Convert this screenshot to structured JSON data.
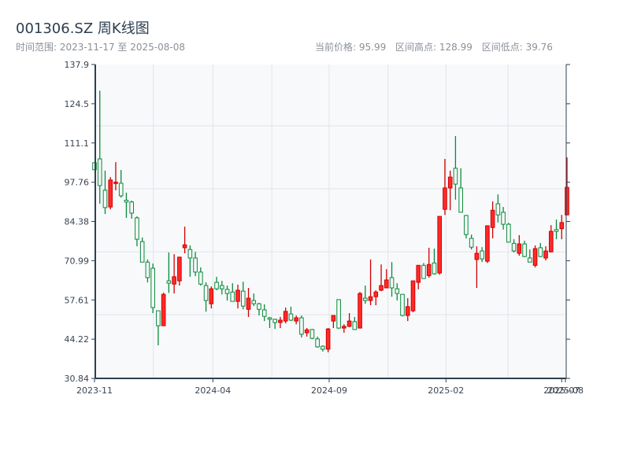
{
  "header": {
    "title": "001306.SZ 周K线图",
    "range_label": "时间范围: 2023-11-17 至 2025-08-08",
    "current_price": "当前价格: 95.99",
    "range_high": "区间高点: 128.99",
    "range_low": "区间低点: 39.76"
  },
  "colors": {
    "up": "#ff2a2a",
    "up_stroke": "#d10000",
    "down": "#0b8a3a",
    "plot_bg": "#f7f9fb",
    "axis": "#2e3f52"
  },
  "chart_data": {
    "type": "candlestick",
    "title": "001306.SZ 周K线图",
    "ylim": [
      30.84,
      137.9
    ],
    "yticks": [
      "137.9",
      "124.5",
      "111.1",
      "97.76",
      "84.38",
      "70.99",
      "57.61",
      "44.22",
      "30.84"
    ],
    "xticks": [
      {
        "label": "2023-11",
        "index": 0
      },
      {
        "label": "2024-04",
        "index": 22.3
      },
      {
        "label": "2024-09",
        "index": 44.2
      },
      {
        "label": "2025-02",
        "index": 66.2
      },
      {
        "label": "2025-07",
        "index": 88.0
      },
      {
        "label": "2025-08",
        "index": 88.7
      }
    ],
    "grid": true,
    "ohlc": [
      [
        104.4,
        104.5,
        101.9,
        102.0
      ],
      [
        105.7,
        128.99,
        90.4,
        96.6
      ],
      [
        95.0,
        101.7,
        86.9,
        89.1
      ],
      [
        89.3,
        99.5,
        88.5,
        98.5
      ],
      [
        97.3,
        104.6,
        95.0,
        97.8
      ],
      [
        97.4,
        101.9,
        92.5,
        93.1
      ],
      [
        91.6,
        94.2,
        85.6,
        91.0
      ],
      [
        91.0,
        91.5,
        85.3,
        87.2
      ],
      [
        85.6,
        86.1,
        75.9,
        78.3
      ],
      [
        77.5,
        78.9,
        70.5,
        70.5
      ],
      [
        70.5,
        71.4,
        63.6,
        65.2
      ],
      [
        68.4,
        70.0,
        53.1,
        55.0
      ],
      [
        53.9,
        53.9,
        42.1,
        48.8
      ],
      [
        48.8,
        60.1,
        48.8,
        59.5
      ],
      [
        64.1,
        73.8,
        60.0,
        63.3
      ],
      [
        63.0,
        73.2,
        59.8,
        65.5
      ],
      [
        64.1,
        72.2,
        62.5,
        72.2
      ],
      [
        75.4,
        82.6,
        73.5,
        76.4
      ],
      [
        74.8,
        76.2,
        65.5,
        71.9
      ],
      [
        71.9,
        74.0,
        65.7,
        67.1
      ],
      [
        67.1,
        68.7,
        62.5,
        63.0
      ],
      [
        62.5,
        63.6,
        53.6,
        57.4
      ],
      [
        56.3,
        62.2,
        54.7,
        61.4
      ],
      [
        63.6,
        65.5,
        60.9,
        61.4
      ],
      [
        62.5,
        64.1,
        59.5,
        61.4
      ],
      [
        61.2,
        62.5,
        57.4,
        59.8
      ],
      [
        60.3,
        63.3,
        57.1,
        57.1
      ],
      [
        57.1,
        62.8,
        54.7,
        60.9
      ],
      [
        60.6,
        63.8,
        54.4,
        55.5
      ],
      [
        54.4,
        61.7,
        51.8,
        58.2
      ],
      [
        57.4,
        59.8,
        55.5,
        56.3
      ],
      [
        56.3,
        56.6,
        52.3,
        54.4
      ],
      [
        54.2,
        56.1,
        50.4,
        52.0
      ],
      [
        51.5,
        51.8,
        48.0,
        51.0
      ],
      [
        51.0,
        51.2,
        47.7,
        49.9
      ],
      [
        49.9,
        51.8,
        48.0,
        50.7
      ],
      [
        50.4,
        55.0,
        49.6,
        53.7
      ],
      [
        52.8,
        55.3,
        50.4,
        50.7
      ],
      [
        50.4,
        52.3,
        49.3,
        51.5
      ],
      [
        51.5,
        52.3,
        44.8,
        45.9
      ],
      [
        46.4,
        48.0,
        45.1,
        47.4
      ],
      [
        47.5,
        47.7,
        44.2,
        44.5
      ],
      [
        44.3,
        45.1,
        41.3,
        41.6
      ],
      [
        41.8,
        42.1,
        40.0,
        40.8
      ],
      [
        40.8,
        48.0,
        39.76,
        47.7
      ],
      [
        50.4,
        52.3,
        48.0,
        52.3
      ],
      [
        57.7,
        57.7,
        47.7,
        48.0
      ],
      [
        48.0,
        49.3,
        46.4,
        48.6
      ],
      [
        48.6,
        53.1,
        48.3,
        50.4
      ],
      [
        50.2,
        51.8,
        47.5,
        47.5
      ],
      [
        48.0,
        60.3,
        48.0,
        59.8
      ],
      [
        58.2,
        62.5,
        56.3,
        57.4
      ],
      [
        57.4,
        71.4,
        55.8,
        58.7
      ],
      [
        58.7,
        60.9,
        55.8,
        60.3
      ],
      [
        60.9,
        69.7,
        60.6,
        62.5
      ],
      [
        61.7,
        68.1,
        61.7,
        64.4
      ],
      [
        65.2,
        70.5,
        58.7,
        61.7
      ],
      [
        61.4,
        63.3,
        57.4,
        59.8
      ],
      [
        59.5,
        59.5,
        52.0,
        52.3
      ],
      [
        52.3,
        58.2,
        50.4,
        55.3
      ],
      [
        53.9,
        64.1,
        53.4,
        64.1
      ],
      [
        63.6,
        69.4,
        61.2,
        69.4
      ],
      [
        69.4,
        70.2,
        64.9,
        64.9
      ],
      [
        65.9,
        75.4,
        65.2,
        69.7
      ],
      [
        70.2,
        75.1,
        66.2,
        66.5
      ],
      [
        66.8,
        86.1,
        66.2,
        86.1
      ],
      [
        88.5,
        105.7,
        86.6,
        95.8
      ],
      [
        95.8,
        101.7,
        88.2,
        99.5
      ],
      [
        102.5,
        113.5,
        91.8,
        97.1
      ],
      [
        95.8,
        102.5,
        87.5,
        87.5
      ],
      [
        86.4,
        86.6,
        78.6,
        79.9
      ],
      [
        78.6,
        79.9,
        74.8,
        75.6
      ],
      [
        71.4,
        75.9,
        61.7,
        73.5
      ],
      [
        74.3,
        75.6,
        70.5,
        71.6
      ],
      [
        70.8,
        82.9,
        70.2,
        82.9
      ],
      [
        82.3,
        91.2,
        78.6,
        88.2
      ],
      [
        90.4,
        93.6,
        84.0,
        86.6
      ],
      [
        87.5,
        89.3,
        81.6,
        83.4
      ],
      [
        83.4,
        83.9,
        77.3,
        77.3
      ],
      [
        76.9,
        78.3,
        73.8,
        74.3
      ],
      [
        73.5,
        79.7,
        72.7,
        76.7
      ],
      [
        76.7,
        77.8,
        72.2,
        72.4
      ],
      [
        71.9,
        74.8,
        70.5,
        70.5
      ],
      [
        69.4,
        76.2,
        68.7,
        75.1
      ],
      [
        75.4,
        77.0,
        72.2,
        72.4
      ],
      [
        71.9,
        75.9,
        71.1,
        74.3
      ],
      [
        74.0,
        83.1,
        73.8,
        81.0
      ],
      [
        81.6,
        85.0,
        78.3,
        81.0
      ],
      [
        81.9,
        86.6,
        78.3,
        84.0
      ],
      [
        86.6,
        106.2,
        86.6,
        95.99
      ]
    ]
  }
}
